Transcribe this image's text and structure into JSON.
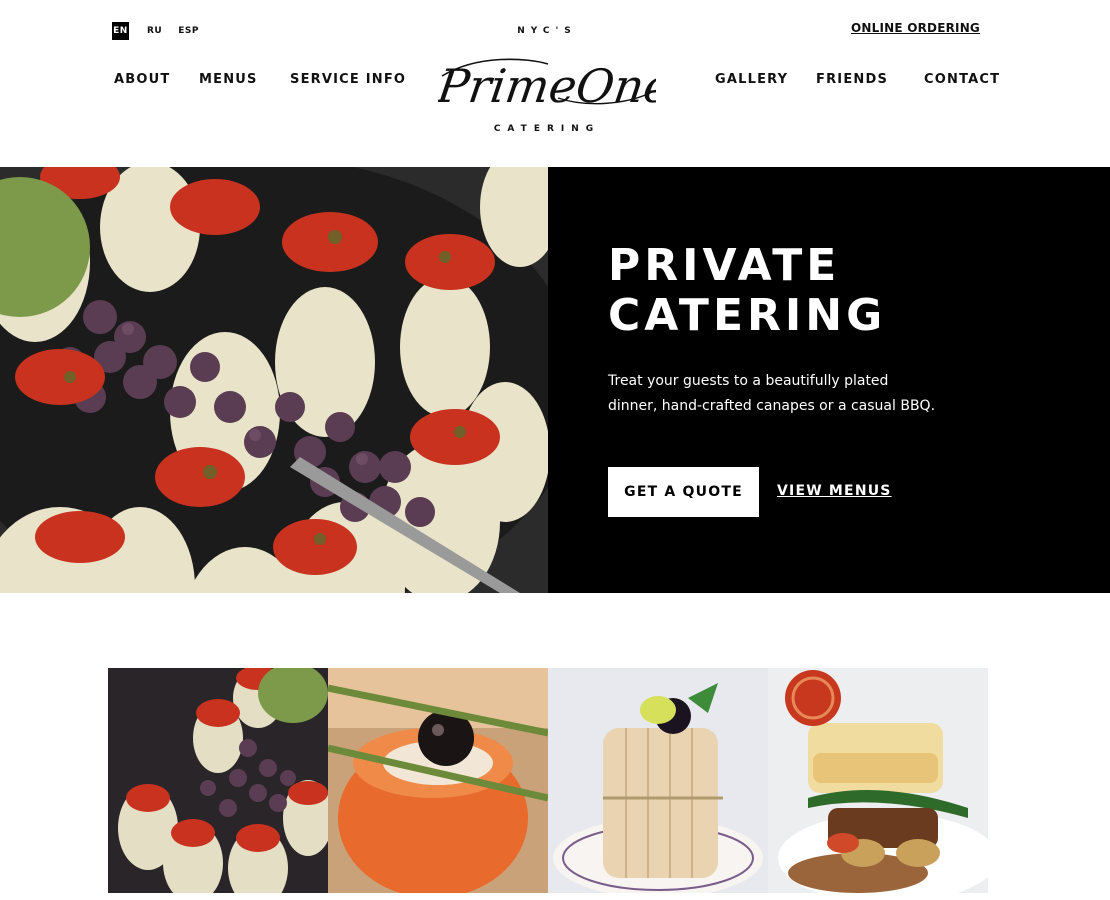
{
  "header": {
    "languages": {
      "active": "EN",
      "others": [
        "RU",
        "ESP"
      ]
    },
    "online_ordering": "ONLINE ORDERING",
    "nav_left": [
      "ABOUT",
      "MENUS",
      "SERVICE INFO"
    ],
    "nav_right": [
      "GALLERY",
      "FRIENDS",
      "CONTACT"
    ],
    "logo": {
      "top": "NYC'S",
      "script": "PrimeOne",
      "bottom": "CATERING"
    }
  },
  "hero": {
    "title": "PRIVATE\nCATERING",
    "subtitle": "Treat your guests to a beautifully plated dinner, hand-crafted canapes or a casual BBQ.",
    "cta_primary": "GET A QUOTE",
    "cta_secondary": "VIEW MENUS"
  },
  "gallery": {
    "tiles": [
      "artichoke-canapes-photo",
      "salmon-caviar-photo",
      "charlotte-dessert-photo",
      "fish-plate-photo"
    ]
  },
  "colors": {
    "accent": "#000000",
    "background": "#ffffff"
  }
}
